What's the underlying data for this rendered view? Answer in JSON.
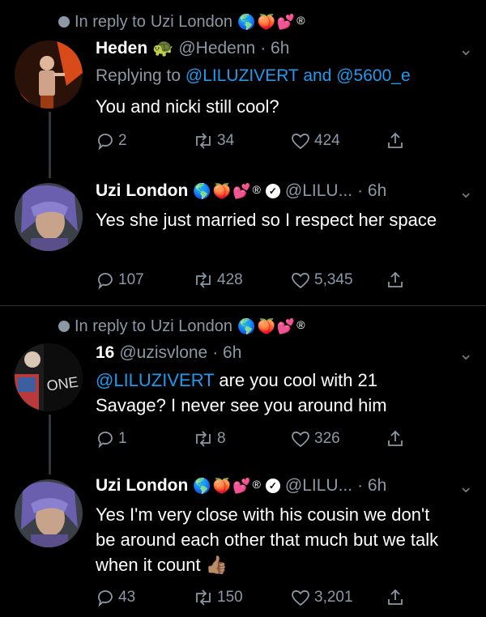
{
  "thread1": {
    "context": {
      "prefix": "In reply to",
      "name": "Uzi London"
    },
    "tweet1": {
      "name": "Heden",
      "handle": "@Hedenn",
      "time": "· 6h",
      "replying_prefix": "Replying to",
      "reply_to_1": "@LILUZIVERT",
      "reply_and": "and",
      "reply_to_2": "@5600_e",
      "text": "You and nicki still cool?",
      "replies": "2",
      "retweets": "34",
      "likes": "424"
    },
    "tweet2": {
      "name": "Uzi London",
      "handle": "@LILU...",
      "time": "· 6h",
      "text": "Yes she just married so I respect her space",
      "replies": "107",
      "retweets": "428",
      "likes": "5,345"
    }
  },
  "thread2": {
    "context": {
      "prefix": "In reply to",
      "name": "Uzi London"
    },
    "tweet1": {
      "name": "16",
      "handle": "@uzisvlone",
      "time": "· 6h",
      "mention": "@LILUZIVERT",
      "text": "are you cool with 21 Savage? I never see you around him",
      "replies": "1",
      "retweets": "8",
      "likes": "326"
    },
    "tweet2": {
      "name": "Uzi London",
      "handle": "@LILU...",
      "time": "· 6h",
      "text": "Yes I'm very close with his cousin we don't be around each other that much but we talk when it count 👍🏽",
      "replies": "43",
      "retweets": "150",
      "likes": "3,201"
    }
  },
  "icons": {
    "globe": "🌎",
    "peach": "🍑",
    "hearts": "💕",
    "registered": "®",
    "turtle": "🐢",
    "chevron": "⌄"
  }
}
